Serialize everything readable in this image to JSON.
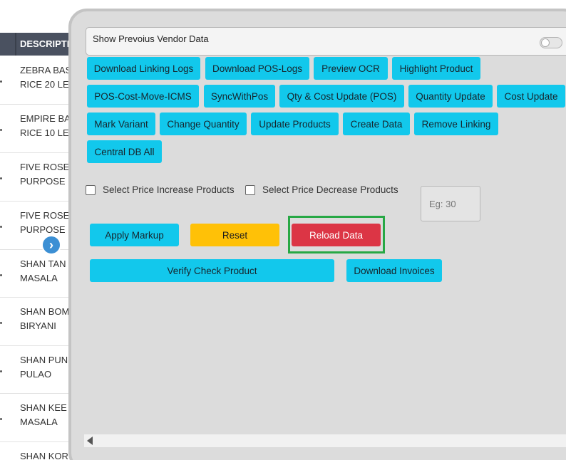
{
  "table": {
    "header": "DESCRIPTI",
    "rows": [
      {
        "line1": "ZEBRA BAS",
        "line2": "RICE 20 LE"
      },
      {
        "line1": "EMPIRE BA",
        "line2": "RICE 10 LE"
      },
      {
        "line1": "FIVE ROSE",
        "line2": "PURPOSE"
      },
      {
        "line1": "FIVE ROSE",
        "line2": "PURPOSE"
      },
      {
        "line1": "SHAN TAN",
        "line2": "MASALA"
      },
      {
        "line1": "SHAN BOM",
        "line2": "BIRYANI"
      },
      {
        "line1": "SHAN PUN",
        "line2": "PULAO"
      },
      {
        "line1": "SHAN KEE",
        "line2": "MASALA"
      },
      {
        "line1": "SHAN KOR",
        "line2": ""
      }
    ]
  },
  "nav": {
    "next_glyph": "›"
  },
  "panel": {
    "vendor_toggle_label": "Show Prevoius Vendor Data",
    "buttons_row1": [
      "Download Linking Logs",
      "Download POS-Logs",
      "Preview OCR",
      "Highlight Product"
    ],
    "buttons_row2": [
      "POS-Cost-Move-ICMS",
      "SyncWithPos",
      "Qty & Cost Update (POS)",
      "Quantity Update",
      "Cost Update"
    ],
    "buttons_row3": [
      "Mark Variant",
      "Change Quantity",
      "Update Products",
      "Create Data",
      "Remove Linking"
    ],
    "buttons_row4": [
      "Central DB All"
    ],
    "checkbox_increase": "Select Price Increase Products",
    "checkbox_decrease": "Select Price Decrease Products",
    "markup_placeholder": "Eg: 30",
    "apply_markup": "Apply Markup",
    "reset": "Reset",
    "reload_data": "Reload Data",
    "verify_check_product": "Verify Check Product",
    "download_invoices": "Download Invoices"
  },
  "colors": {
    "primary_button": "#12c8ec",
    "warning_button": "#ffc107",
    "danger_button": "#dc3545",
    "highlight_border": "#27a845",
    "table_header": "#4a5160"
  }
}
